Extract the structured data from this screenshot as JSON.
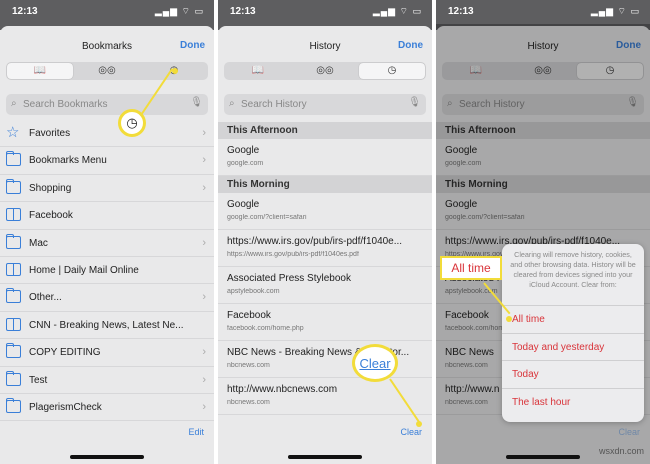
{
  "status": {
    "time": "12:13",
    "icons": "▂▄▆ ⌔ ▭"
  },
  "panel1": {
    "title": "Bookmarks",
    "done": "Done",
    "tabs": [
      "📖",
      "◎◎",
      "◷"
    ],
    "search_placeholder": "Search Bookmarks",
    "items": [
      {
        "label": "Favorites",
        "icon": "star-icon"
      },
      {
        "label": "Bookmarks Menu",
        "icon": "folder-icon"
      },
      {
        "label": "Shopping",
        "icon": "folder-icon"
      },
      {
        "label": "Facebook",
        "icon": "book-icon"
      },
      {
        "label": "Mac",
        "icon": "folder-icon"
      },
      {
        "label": "Home | Daily Mail Online",
        "icon": "book-icon"
      },
      {
        "label": "Other...",
        "icon": "folder-icon"
      },
      {
        "label": "CNN - Breaking News, Latest Ne...",
        "icon": "book-icon"
      },
      {
        "label": "COPY EDITING",
        "icon": "folder-icon"
      },
      {
        "label": "Test",
        "icon": "folder-icon"
      },
      {
        "label": "PlagerismCheck",
        "icon": "folder-icon"
      }
    ],
    "edit": "Edit",
    "callout_icon": "◷"
  },
  "panel2": {
    "title": "History",
    "done": "Done",
    "search_placeholder": "Search History",
    "section1": "This Afternoon",
    "section2": "This Morning",
    "afternoon": [
      {
        "title": "Google",
        "url": "google.com"
      }
    ],
    "morning": [
      {
        "title": "Google",
        "url": "google.com/?client=safari"
      },
      {
        "title": "https://www.irs.gov/pub/irs-pdf/f1040e...",
        "url": "https://www.irs.gov/pub/irs-pdf/f1040es.pdf"
      },
      {
        "title": "Associated Press Stylebook",
        "url": "apstylebook.com"
      },
      {
        "title": "Facebook",
        "url": "facebook.com/home.php"
      },
      {
        "title": "NBC News - Breaking News & Top Stor...",
        "url": "nbcnews.com"
      },
      {
        "title": "http://www.nbcnews.com",
        "url": "nbcnews.com"
      }
    ],
    "clear": "Clear",
    "callout_clear": "Clear"
  },
  "panel3": {
    "title": "History",
    "done": "Done",
    "search_placeholder": "Search History",
    "section1": "This Afternoon",
    "section2": "This Morning",
    "afternoon": [
      {
        "title": "Google",
        "url": "google.com"
      }
    ],
    "morning": [
      {
        "title": "Google",
        "url": "google.com/?client=safari"
      },
      {
        "title": "https://www.irs.gov/pub/irs-pdf/f1040e...",
        "url": "https://www.irs.gov/pub/irs-pdf/f1040es.pdf"
      },
      {
        "title": "Associated Press Stylebook",
        "url": "apstylebook.com"
      },
      {
        "title": "Facebook",
        "url": "facebook.com/home.php"
      },
      {
        "title": "NBC News",
        "url": "nbcnews.com"
      },
      {
        "title": "http://www.n",
        "url": "nbcnews.com"
      }
    ],
    "clear": "Clear",
    "sheet_message": "Clearing will remove history, cookies, and other browsing data. History will be cleared from devices signed into your iCloud Account. Clear from:",
    "options": [
      "All time",
      "Today and yesterday",
      "Today",
      "The last hour"
    ],
    "callout_label": "All time"
  },
  "watermark": "wsxdn.com",
  "colors": {
    "accent": "#3a7fd8",
    "destructive": "#d9343a",
    "highlight": "#f2dc3a"
  }
}
